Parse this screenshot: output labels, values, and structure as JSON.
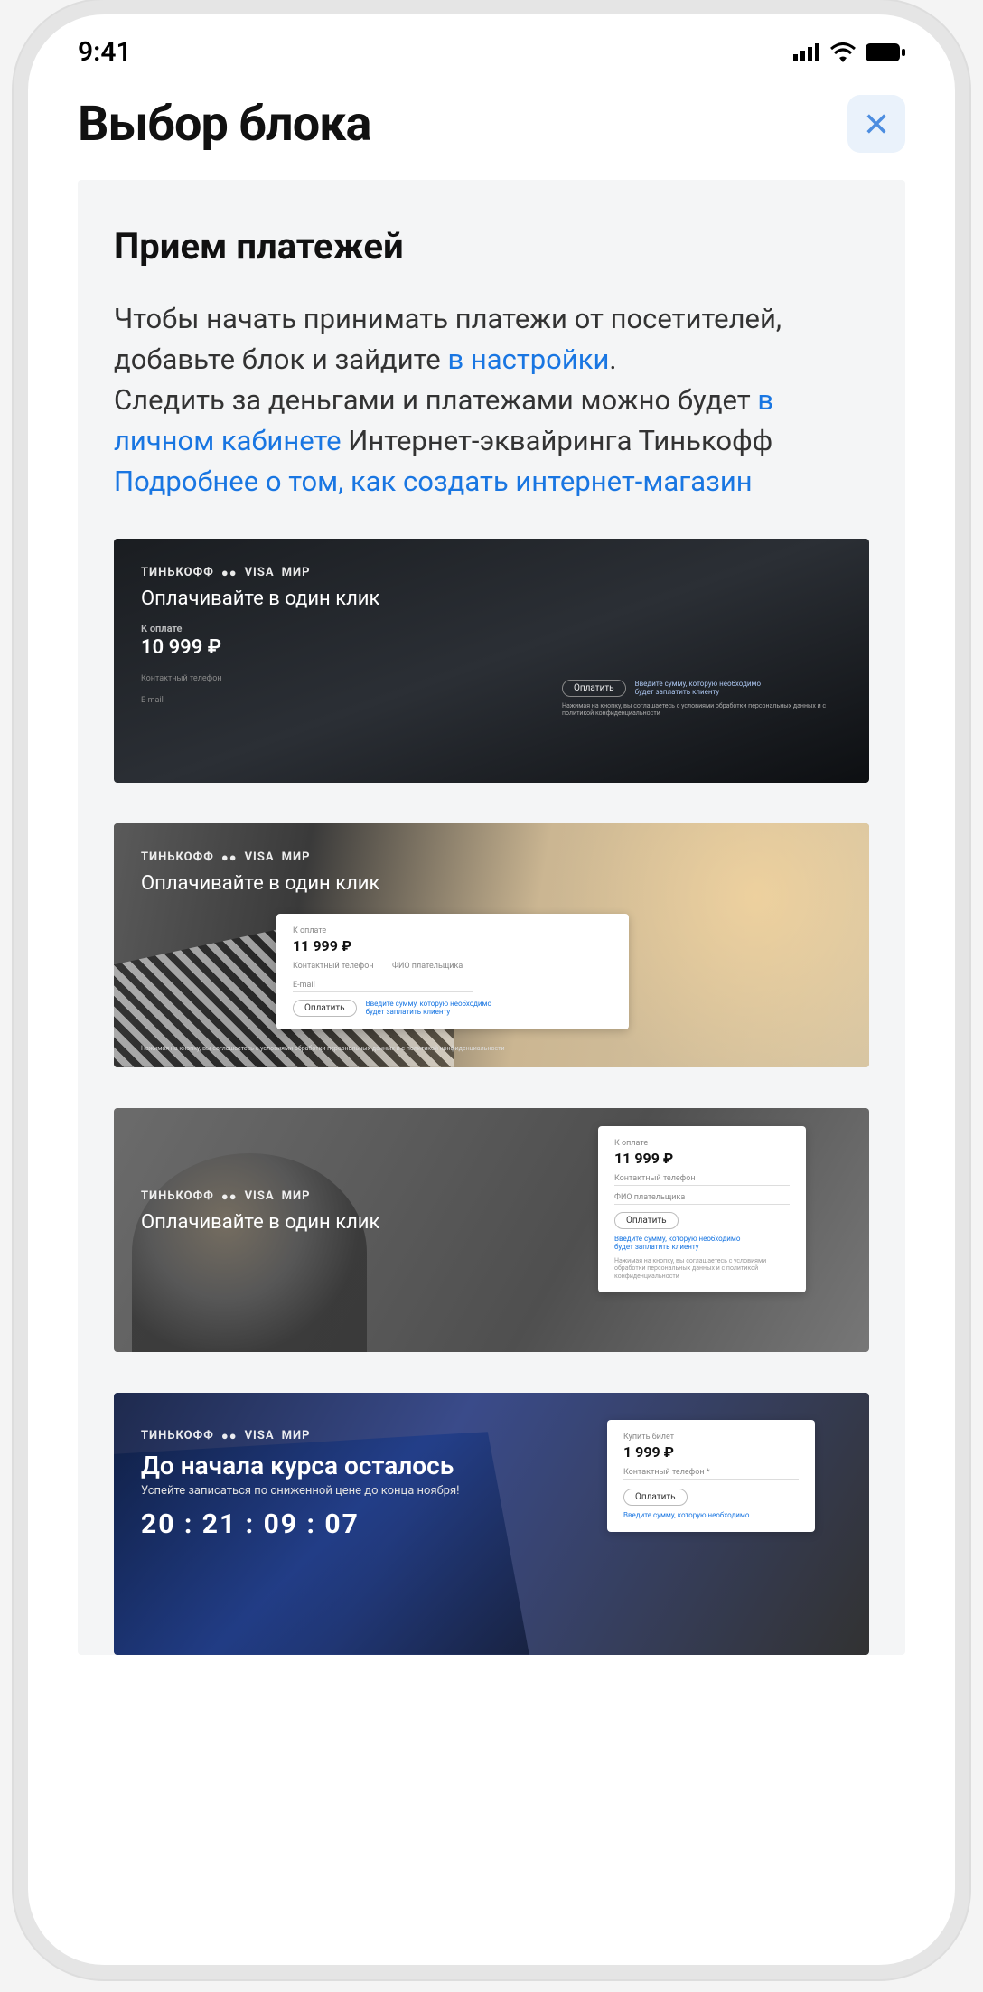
{
  "status": {
    "time": "9:41"
  },
  "header": {
    "title": "Выбор блока"
  },
  "section": {
    "title": "Прием платежей",
    "intro_1a": "Чтобы начать принимать платежи от посетителей, добавьте блок и зайдите ",
    "intro_link1": "в настройки",
    "intro_1b": ".",
    "intro_2a": "Следить за деньгами и платежами можно будет ",
    "intro_link2": "в личном кабинете",
    "intro_2b": " Интернет-эквайринга Тинькофф",
    "intro_link3": "Подробнее о том, как создать интернет-магазин"
  },
  "logos": {
    "brand": "ТИНЬКОФФ",
    "mc": "●●",
    "visa": "VISA",
    "mir": "МИР"
  },
  "common": {
    "heading": "Оплачивайте в один клик",
    "to_pay_label": "К оплате",
    "pay_btn": "Оплатить",
    "hint_line1": "Введите сумму, которую необходимо",
    "hint_line2": "будет заплатить клиенту",
    "field_phone": "Контактный телефон",
    "field_fio": "ФИО плательщика",
    "field_email": "E-mail",
    "disclaimer": "Нажимая на кнопку, вы соглашаетесь с условиями обработки персональных данных и с политикой конфиденциальности"
  },
  "cards": [
    {
      "price": "10 999 ₽"
    },
    {
      "price": "11 999 ₽"
    },
    {
      "price": "11 999 ₽"
    },
    {
      "buy_label": "Купить билет",
      "price": "1 999 ₽",
      "field_phone_req": "Контактный телефон *",
      "heading": "До начала курса осталось",
      "sub": "Успейте записаться по сниженной цене до конца ноября!",
      "timer": "20 : 21 : 09 : 07"
    }
  ]
}
